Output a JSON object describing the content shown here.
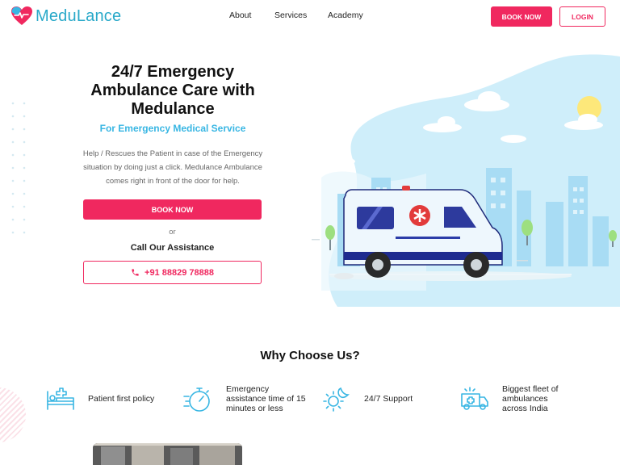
{
  "header": {
    "logo_text": "MeduLance",
    "nav": [
      {
        "label": "About"
      },
      {
        "label": "Services"
      },
      {
        "label": "Academy"
      }
    ],
    "book_now_label": "BOOK NOW",
    "login_label": "LOGIN"
  },
  "hero": {
    "title": "24/7 Emergency Ambulance Care with Medulance",
    "subtitle": "For Emergency Medical Service",
    "description": "Help / Rescues the Patient in case of the Emergency situation by doing just a click. Medulance Ambulance comes right in front of the door for help.",
    "book_now_label": "BOOK NOW",
    "or_text": "or",
    "call_label": "Call Our Assistance",
    "phone": "+91 88829 78888"
  },
  "why": {
    "title": "Why Choose Us?",
    "features": [
      {
        "icon": "hospital-bed-icon",
        "label": "Patient first policy"
      },
      {
        "icon": "stopwatch-icon",
        "label": "Emergency assistance time of 15 minutes or less"
      },
      {
        "icon": "day-night-icon",
        "label": "24/7 Support"
      },
      {
        "icon": "ambulance-icon",
        "label": "Biggest fleet of ambulances across India"
      }
    ]
  },
  "colors": {
    "brand_pink": "#f0285f",
    "brand_blue": "#38b6e3",
    "logo_blue": "#29a9c9"
  }
}
